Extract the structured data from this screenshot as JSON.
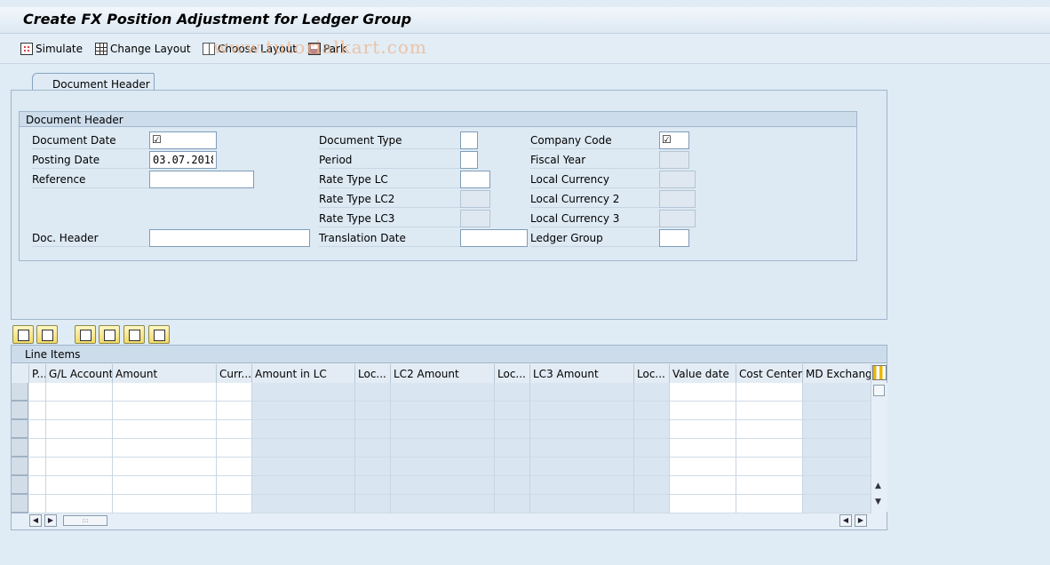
{
  "window": {
    "title": "Create FX Position Adjustment for Ledger Group"
  },
  "watermark": "www.tutorialkart.com",
  "toolbar": {
    "simulate": "Simulate",
    "change_layout": "Change Layout",
    "choose_layout": "Choose Layout",
    "park": "Park"
  },
  "tabs": [
    {
      "label": "Document Header"
    }
  ],
  "header_group": {
    "title": "Document Header",
    "fields": {
      "document_date": {
        "label": "Document Date",
        "value": ""
      },
      "posting_date": {
        "label": "Posting Date",
        "value": "03.07.2018"
      },
      "reference": {
        "label": "Reference",
        "value": ""
      },
      "doc_header": {
        "label": "Doc. Header",
        "value": ""
      },
      "document_type": {
        "label": "Document Type",
        "value": ""
      },
      "period": {
        "label": "Period",
        "value": ""
      },
      "rate_type_lc": {
        "label": "Rate Type LC",
        "value": ""
      },
      "rate_type_lc2": {
        "label": "Rate Type LC2",
        "value": ""
      },
      "rate_type_lc3": {
        "label": "Rate Type LC3",
        "value": ""
      },
      "translation_date": {
        "label": "Translation Date",
        "value": ""
      },
      "company_code": {
        "label": "Company Code",
        "value": ""
      },
      "fiscal_year": {
        "label": "Fiscal Year",
        "value": ""
      },
      "local_currency": {
        "label": "Local Currency",
        "value": ""
      },
      "local_currency_2": {
        "label": "Local Currency 2",
        "value": ""
      },
      "local_currency_3": {
        "label": "Local Currency 3",
        "value": ""
      },
      "ledger_group": {
        "label": "Ledger Group",
        "value": ""
      }
    }
  },
  "line_items": {
    "title": "Line Items",
    "columns": [
      "P...",
      "G/L Account",
      "Amount",
      "Curr...",
      "Amount in LC",
      "Loc...",
      "LC2 Amount",
      "Loc...",
      "LC3 Amount",
      "Loc...",
      "Value date",
      "Cost Center",
      "MD Exchange"
    ]
  }
}
